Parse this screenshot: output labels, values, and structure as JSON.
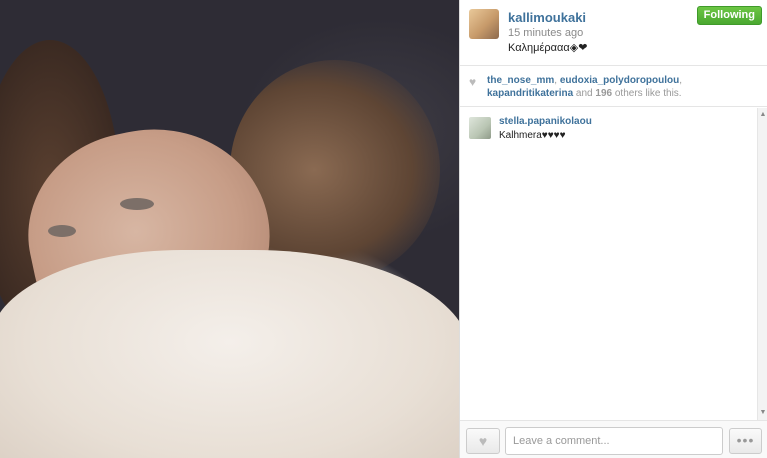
{
  "photo": {
    "alt": ""
  },
  "post": {
    "username": "kallimoukaki",
    "time_ago": "15 minutes ago",
    "caption": "Καλημέρααα◈❤",
    "follow_label": "Following",
    "follow_color": "#4aa830"
  },
  "likes": {
    "users": [
      "the_nose_mm",
      "eudoxia_polydoropoulou",
      "kapandritikaterina"
    ],
    "sep1": ", ",
    "sep2": ",",
    "and_text": " and ",
    "others_count": "196",
    "others_text": " others like this."
  },
  "comments": [
    {
      "user": "stella.papanikolaou",
      "text": "Kalhmera♥♥♥♥"
    }
  ],
  "footer": {
    "comment_placeholder": "Leave a comment...",
    "more_label": "•••",
    "like_icon": "heart-icon"
  },
  "scrollbar": {
    "up": "▲",
    "down": "▼"
  },
  "colors": {
    "link": "#3f729b",
    "muted": "#999999"
  }
}
